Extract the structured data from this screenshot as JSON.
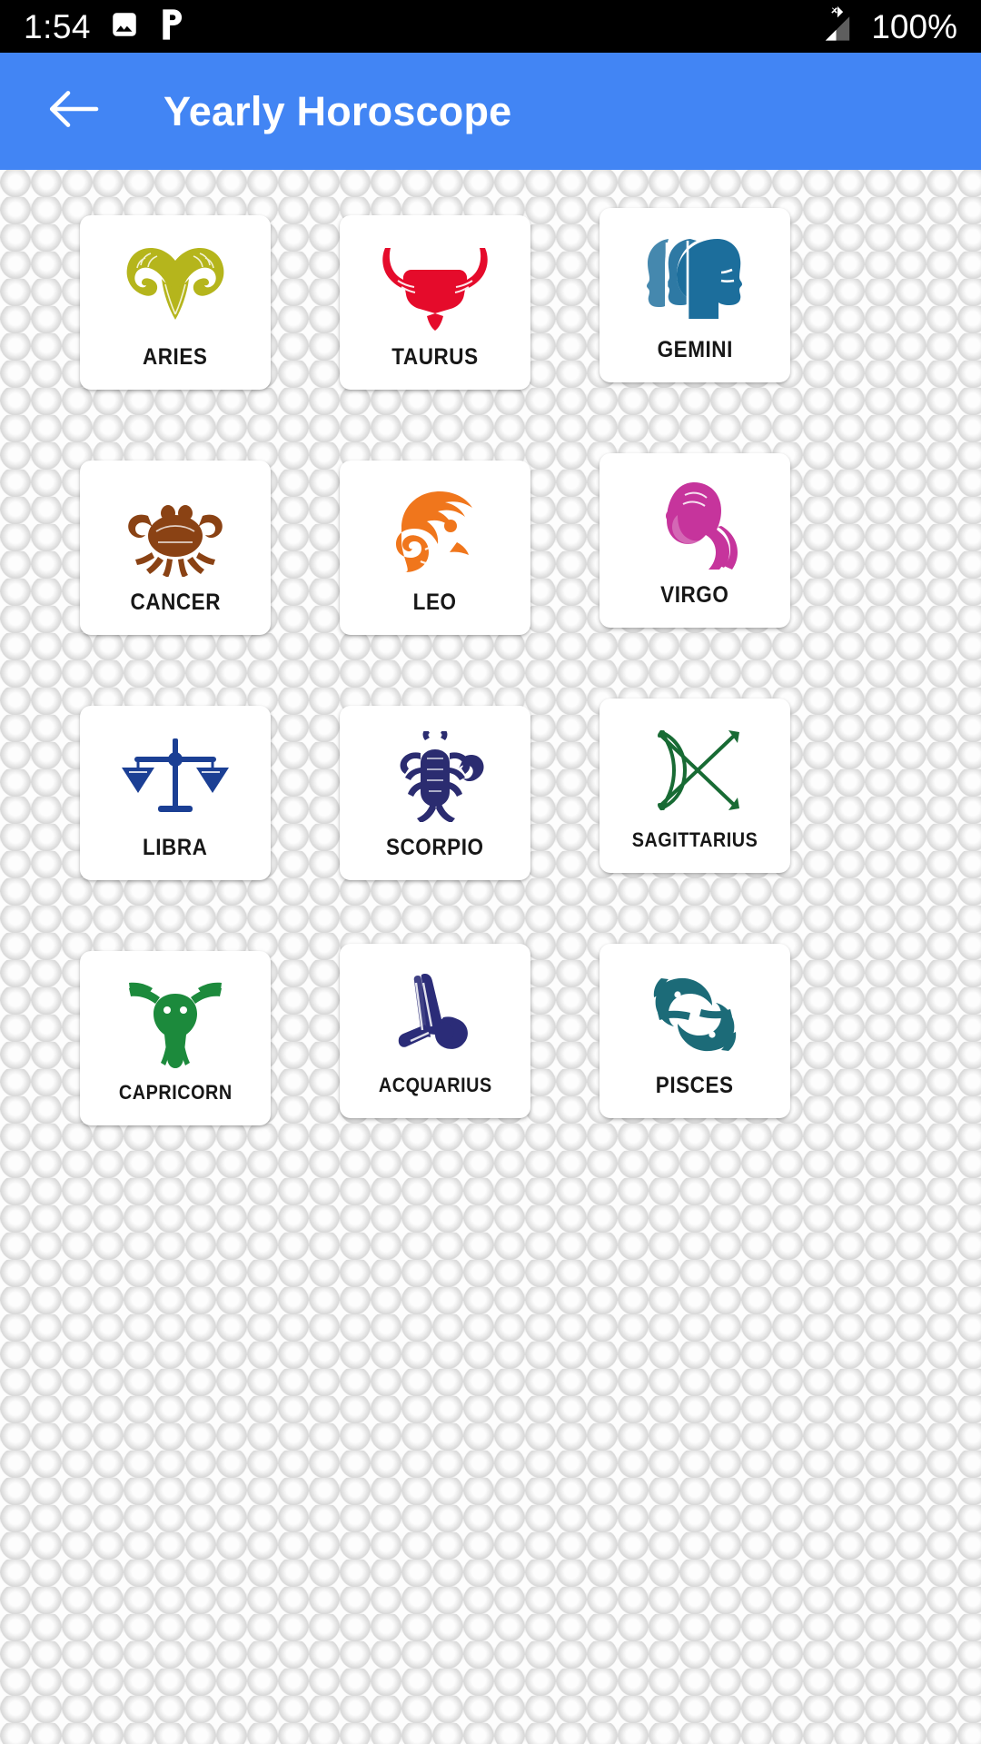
{
  "status_bar": {
    "time": "1:54",
    "battery": "100%",
    "icons": [
      {
        "name": "gallery-icon"
      },
      {
        "name": "pandora-p-icon"
      },
      {
        "name": "no-sim-signal-icon"
      }
    ]
  },
  "app_bar": {
    "back_label": "back-arrow",
    "title": "Yearly Horoscope",
    "background_color": "#4285f4",
    "title_color": "#ffffff"
  },
  "grid": {
    "columns": 3,
    "signs": [
      {
        "label": "ARIES",
        "icon": "aries-ram-icon",
        "color": "#b5b51c"
      },
      {
        "label": "TAURUS",
        "icon": "taurus-bull-icon",
        "color": "#e50b2b"
      },
      {
        "label": "GEMINI",
        "icon": "gemini-twins-icon",
        "color": "#1c6e9c"
      },
      {
        "label": "CANCER",
        "icon": "cancer-crab-icon",
        "color": "#8a4214"
      },
      {
        "label": "LEO",
        "icon": "leo-lion-icon",
        "color": "#f0761c"
      },
      {
        "label": "VIRGO",
        "icon": "virgo-maiden-icon",
        "color": "#c6349c"
      },
      {
        "label": "LIBRA",
        "icon": "libra-scales-icon",
        "color": "#1b3f94"
      },
      {
        "label": "SCORPIO",
        "icon": "scorpio-scorpion-icon",
        "color": "#2b2c70"
      },
      {
        "label": "SAGITTARIUS",
        "icon": "sagittarius-bow-icon",
        "color": "#186b34"
      },
      {
        "label": "CAPRICORN",
        "icon": "capricorn-goat-icon",
        "color": "#1c8a3c"
      },
      {
        "label": "ACQUARIUS",
        "icon": "aquarius-vessel-icon",
        "color": "#2b2c78"
      },
      {
        "label": "PISCES",
        "icon": "pisces-fish-icon",
        "color": "#1c6b78"
      }
    ]
  }
}
